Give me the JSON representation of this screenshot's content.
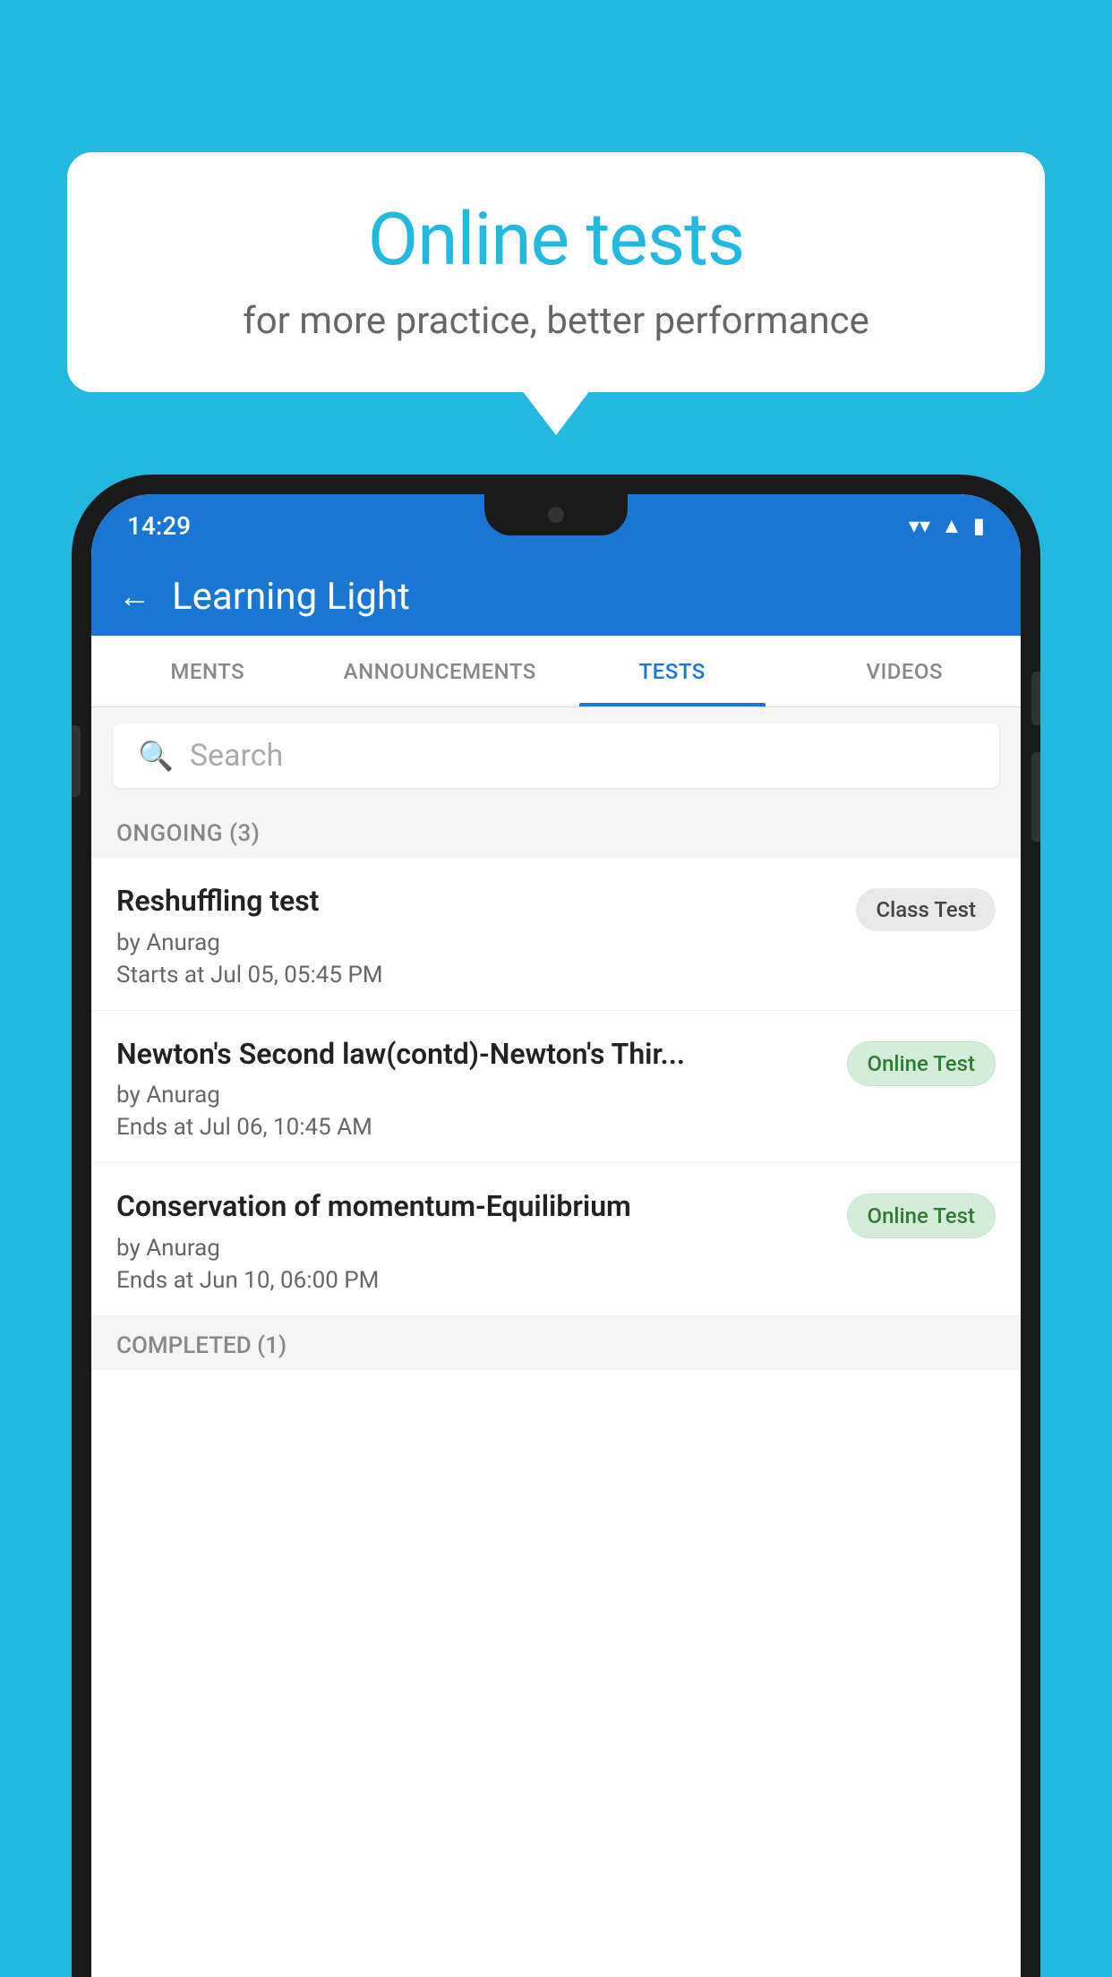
{
  "background_color": "#22b8e0",
  "speech_bubble": {
    "title": "Online tests",
    "subtitle": "for more practice, better performance"
  },
  "phone": {
    "status_bar": {
      "time": "14:29",
      "icons": [
        "wifi",
        "signal",
        "battery"
      ]
    },
    "app_header": {
      "title": "Learning Light",
      "back_label": "←"
    },
    "tabs": [
      {
        "label": "MENTS",
        "active": false
      },
      {
        "label": "ANNOUNCEMENTS",
        "active": false
      },
      {
        "label": "TESTS",
        "active": true
      },
      {
        "label": "VIDEOS",
        "active": false
      }
    ],
    "search": {
      "placeholder": "Search"
    },
    "section_ongoing": {
      "label": "ONGOING (3)"
    },
    "tests": [
      {
        "name": "Reshuffling test",
        "author": "by Anurag",
        "time_label": "Starts at",
        "time": "Jul 05, 05:45 PM",
        "badge": "Class Test",
        "badge_type": "class"
      },
      {
        "name": "Newton's Second law(contd)-Newton's Thir...",
        "author": "by Anurag",
        "time_label": "Ends at",
        "time": "Jul 06, 10:45 AM",
        "badge": "Online Test",
        "badge_type": "online"
      },
      {
        "name": "Conservation of momentum-Equilibrium",
        "author": "by Anurag",
        "time_label": "Ends at",
        "time": "Jun 10, 06:00 PM",
        "badge": "Online Test",
        "badge_type": "online"
      }
    ],
    "section_completed": {
      "label": "COMPLETED (1)"
    }
  }
}
